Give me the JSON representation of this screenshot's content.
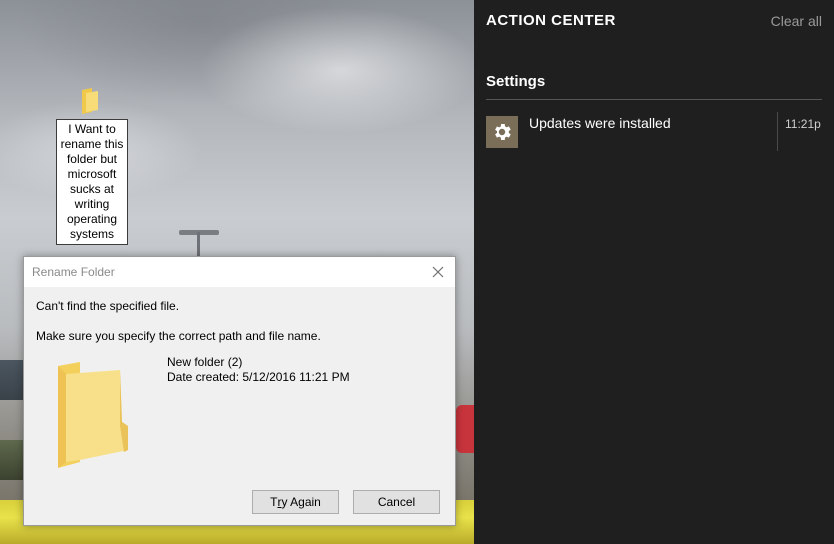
{
  "desktop": {
    "folder_label": "I Want to rename this folder but microsoft sucks at writing operating systems"
  },
  "dialog": {
    "title": "Rename Folder",
    "message_line1": "Can't find the specified file.",
    "message_line2": "Make sure you specify the correct path and file name.",
    "file_name": "New folder (2)",
    "date_created": "Date created: 5/12/2016 11:21 PM",
    "try_again_label": "Try Again",
    "try_again_mnemonic": "r",
    "cancel_label": "Cancel"
  },
  "action_center": {
    "title": "ACTION CENTER",
    "clear_all_label": "Clear all",
    "group_label": "Settings",
    "notification": {
      "icon": "gear-icon",
      "text": "Updates were installed",
      "time": "11:21p"
    }
  },
  "colors": {
    "action_center_bg": "#1f1f1f",
    "notification_icon_bg": "#7a6e58",
    "folder_yellow": "#f5d56b",
    "dialog_bg": "#f0f0f0"
  }
}
